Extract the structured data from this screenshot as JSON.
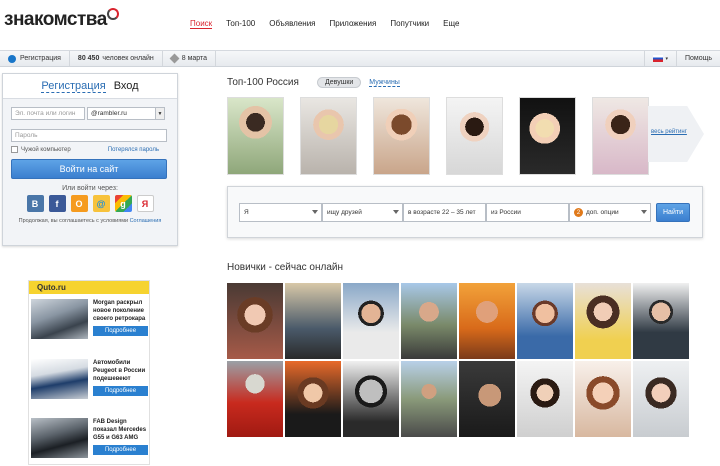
{
  "header": {
    "logo": "знакомства"
  },
  "nav": [
    "Поиск",
    "Топ-100",
    "Объявления",
    "Приложения",
    "Попутчики",
    "Еще"
  ],
  "subbar": {
    "register": "Регистрация",
    "online_count": "80 450",
    "online_label": "человек онлайн",
    "date": "8 марта",
    "help": "Помощь"
  },
  "login": {
    "tab_register": "Регистрация",
    "tab_login": "Вход",
    "email_placeholder": "Эл. почта или логин",
    "domain": "@rambler.ru",
    "password_placeholder": "Пароль",
    "foreign_computer": "Чужой компьютер",
    "forgot": "Потерялся пароль",
    "button": "Войти на сайт",
    "social_title": "Или войти через:",
    "terms_text": "Продолжая, вы соглашаетесь с условиями",
    "terms_link": "Соглашения"
  },
  "social": [
    {
      "name": "vk",
      "glyph": "В",
      "color": "#4a76a8"
    },
    {
      "name": "facebook",
      "glyph": "f",
      "color": "#3b5998"
    },
    {
      "name": "odnoklassniki",
      "glyph": "О",
      "color": "#f59b1f"
    },
    {
      "name": "mailru",
      "glyph": "@",
      "color": "#168de2"
    },
    {
      "name": "google",
      "glyph": "g",
      "color": "#4caf50"
    },
    {
      "name": "yandex",
      "glyph": "Я",
      "color": "#ffffff"
    }
  ],
  "ad": {
    "brand": "Quto.ru",
    "items": [
      {
        "text": "Morgan раскрыл новое поколение своего ретрокара",
        "button": "Подробнее"
      },
      {
        "text": "Автомобили Peugeot в России подешевеют",
        "button": "Подробнее"
      },
      {
        "text": "FAB Design показал Mercedes G55 и G63 AMG",
        "button": "Подробнее"
      }
    ]
  },
  "top100": {
    "title": "Топ-100 Россия",
    "girls": "Девушки",
    "men": "Мужчины",
    "all_rating": "весь рейтинг"
  },
  "search": {
    "gender": "Я",
    "looking_for": "ищу друзей",
    "age": "в возрасте  22 – 35  лет",
    "location": "из России",
    "options_count": "2",
    "options_label": "доп. опции",
    "button": "Найти"
  },
  "newbies": {
    "title": "Новички - сейчас онлайн"
  },
  "colors": {
    "accent": "#d9232d",
    "link": "#2a6db3",
    "button": "#3b7fcf"
  }
}
